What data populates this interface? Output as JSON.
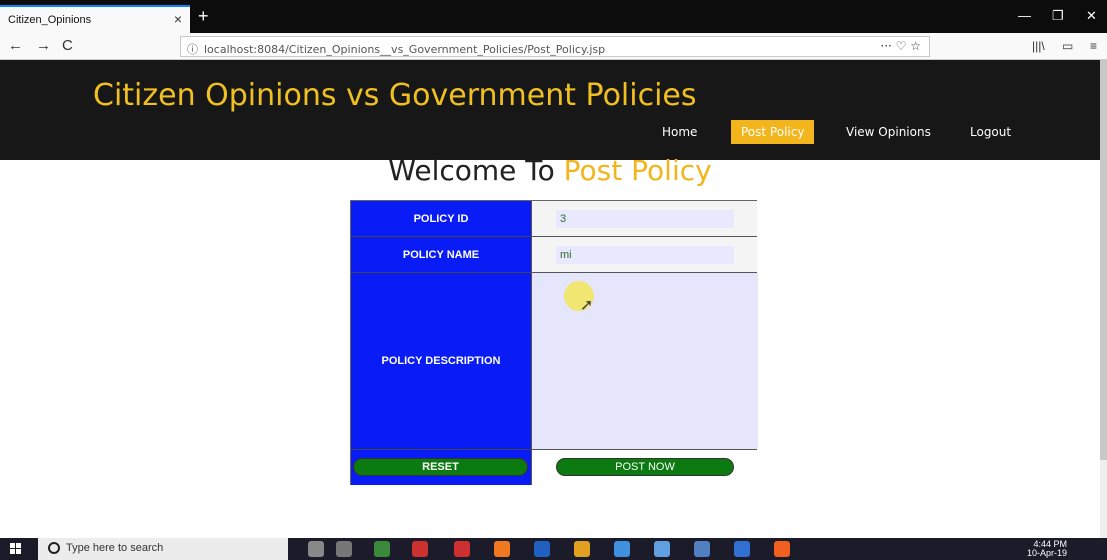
{
  "browser": {
    "tab_title": "Citizen_Opinions",
    "tab_close": "×",
    "new_tab": "+",
    "url": "localhost:8084/Citizen_Opinions__vs_Government_Policies/Post_Policy.jsp",
    "back": "←",
    "forward": "→",
    "reload": "C"
  },
  "site": {
    "title": "Citizen Opinions vs Government Policies",
    "nav": [
      "Home",
      "Post Policy",
      "View Opinions",
      "Logout"
    ],
    "active_nav": "Post Policy"
  },
  "page": {
    "welcome_prefix": "Welcome To ",
    "welcome_accent": "Post Policy"
  },
  "form": {
    "policy_id_label": "POLICY ID",
    "policy_id_value": "3",
    "policy_name_label": "POLICY NAME",
    "policy_name_value": "mi",
    "policy_description_label": "POLICY DESCRIPTION",
    "policy_description_value": "",
    "reset_label": "RESET",
    "submit_label": "POST NOW"
  },
  "taskbar": {
    "search_placeholder": "Type here to search",
    "time": "4:44 PM",
    "date": "10-Apr-19"
  },
  "colors": {
    "accent": "#f2b51b",
    "header_bg": "#171717",
    "label_bg": "#0a1cf5",
    "button_bg": "#0b7a10"
  }
}
